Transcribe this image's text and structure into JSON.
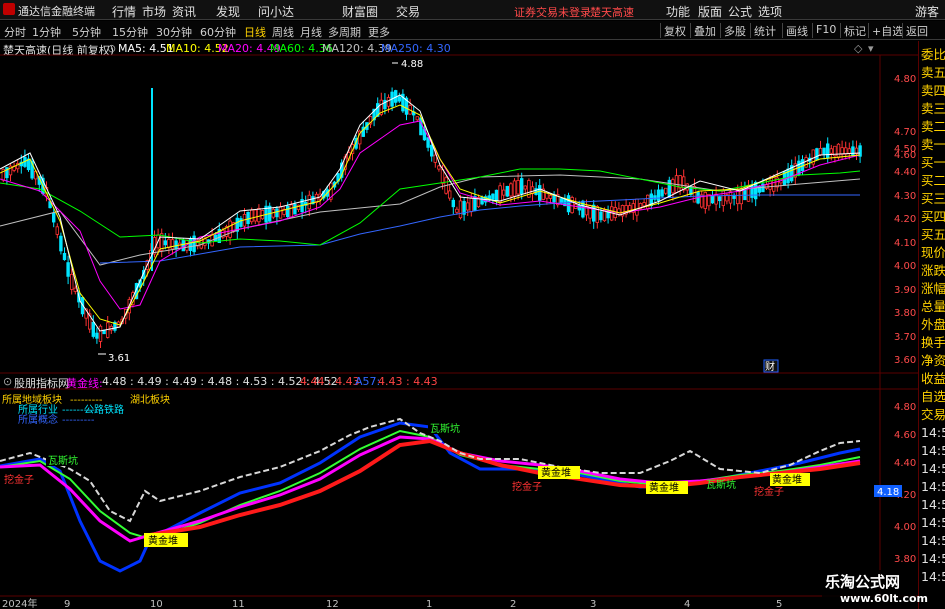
{
  "titlebar": {
    "app_name": "通达信金融终端",
    "menus": [
      "行情",
      "市场",
      "资讯",
      "发现",
      "问小达",
      "财富圈",
      "交易"
    ],
    "notice_login": "证券交易未登录",
    "notice_stock": "楚天高速",
    "right_menus": [
      "功能",
      "版面",
      "公式",
      "选项"
    ],
    "guest": "游客"
  },
  "periods": [
    "分时",
    "1分钟",
    "5分钟",
    "15分钟",
    "30分钟",
    "60分钟",
    "日线",
    "周线",
    "月线",
    "多周期",
    "更多"
  ],
  "active_period": "日线",
  "tools": [
    "复权",
    "叠加",
    "多股",
    "统计",
    "画线",
    "F10",
    "标记",
    "+自选",
    "返回"
  ],
  "upper_info": {
    "title": "楚天高速(日线 前复权)",
    "ma": [
      {
        "label": "MA5: 4.51",
        "color": "#ffffff"
      },
      {
        "label": "MA10: 4.52",
        "color": "#ffff00"
      },
      {
        "label": "MA20: 4.49",
        "color": "#ff00ff"
      },
      {
        "label": "MA60: 4.36",
        "color": "#00ff00"
      },
      {
        "label": "MA120: 4.39",
        "color": "#c0c0c0"
      },
      {
        "label": "MA250: 4.30",
        "color": "#3366ff"
      }
    ]
  },
  "lower_info": {
    "title": "股朋指标网",
    "line_name": "黄金线:",
    "values_white": "4.48 : 4.49 : 4.49 : 4.48 : 4.53 : 4.52 : 4.52",
    "values_red": "4.44 : 4.43",
    "line_name2": "A57:",
    "values_tail": "4.43 : 4.43"
  },
  "upper_axis": [
    "4.80",
    "4.70",
    "4.60",
    "4.50",
    "4.40",
    "4.30",
    "4.20",
    "4.10",
    "4.00",
    "3.90",
    "3.80",
    "3.70",
    "3.60"
  ],
  "lower_axis": [
    "4.80",
    "4.60",
    "4.40",
    "4.20",
    "4.00",
    "3.80"
  ],
  "price_tag": "4.18",
  "annotations": {
    "high": "4.88",
    "low": "3.61",
    "fin_marker": "财",
    "sector_region": "所属地域板块",
    "sector_region_value": "湖北板块",
    "sector_industry": "所属行业",
    "sector_industry_value": "公路铁路",
    "sector_concept": "所属概念"
  },
  "signals": [
    {
      "text": "瓦斯坑",
      "color": "#33ff33",
      "bg": "#000"
    },
    {
      "text": "挖金子",
      "color": "#ff3333",
      "bg": "#000"
    },
    {
      "text": "黄金堆",
      "color": "#000",
      "bg": "#ffff00"
    },
    {
      "text": "瓦斯坑",
      "color": "#33ff33",
      "bg": "#000"
    },
    {
      "text": "黄金堆",
      "color": "#000",
      "bg": "#ffff00"
    },
    {
      "text": "挖金子",
      "color": "#ff3333",
      "bg": "#000"
    },
    {
      "text": "黄金堆",
      "color": "#000",
      "bg": "#ffff00"
    },
    {
      "text": "瓦斯坑",
      "color": "#33ff33",
      "bg": "#000"
    },
    {
      "text": "黄金堆",
      "color": "#000",
      "bg": "#ffff00"
    },
    {
      "text": "挖金子",
      "color": "#ff3333",
      "bg": "#000"
    }
  ],
  "time_axis": [
    "2024年",
    "9",
    "10",
    "11",
    "12",
    "1",
    "2",
    "3",
    "4",
    "5"
  ],
  "right_panel": {
    "quote": [
      "委比",
      "卖五",
      "卖四",
      "卖三",
      "卖二",
      "卖一",
      "买一",
      "买二",
      "买三",
      "买四",
      "买五"
    ],
    "stats": [
      "现价",
      "涨跌",
      "涨幅",
      "总量",
      "外盘",
      "换手",
      "净资",
      "收益"
    ],
    "lower": [
      "自选",
      "交易",
      "14:56",
      "14:56",
      "14:56",
      "14:56",
      "14:56",
      "14:56",
      "14:56",
      "14:56",
      "14:56"
    ]
  },
  "watermark": {
    "line1": "乐淘公式网",
    "line2": "www.60lt.com"
  },
  "colors": {
    "up": "#ff3333",
    "down": "#00e5ff",
    "accent": "#ffd200",
    "grid": "#5a0000"
  }
}
